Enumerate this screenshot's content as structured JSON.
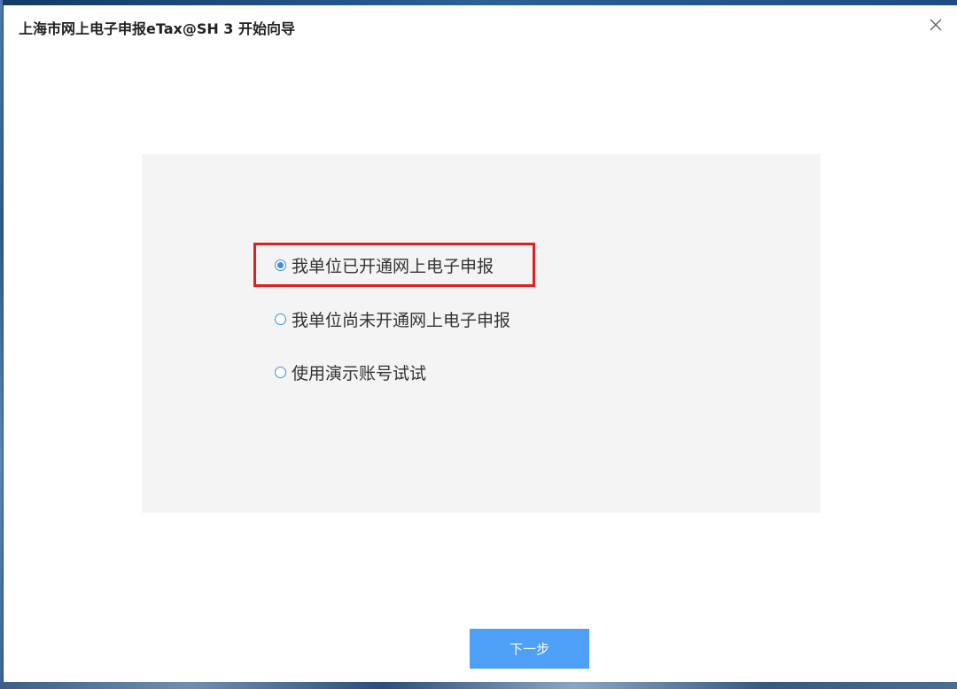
{
  "dialog": {
    "title": "上海市网上电子申报eTax@SH 3 开始向导",
    "close_icon": "close-icon"
  },
  "options": [
    {
      "label": "我单位已开通网上电子申报",
      "selected": true
    },
    {
      "label": "我单位尚未开通网上电子申报",
      "selected": false
    },
    {
      "label": "使用演示账号试试",
      "selected": false
    }
  ],
  "footer": {
    "next_label": "下一步"
  },
  "colors": {
    "accent": "#4d9ff7",
    "radio": "#3a8ee6",
    "highlight": "#e02020",
    "panel_bg": "#f4f4f4"
  }
}
